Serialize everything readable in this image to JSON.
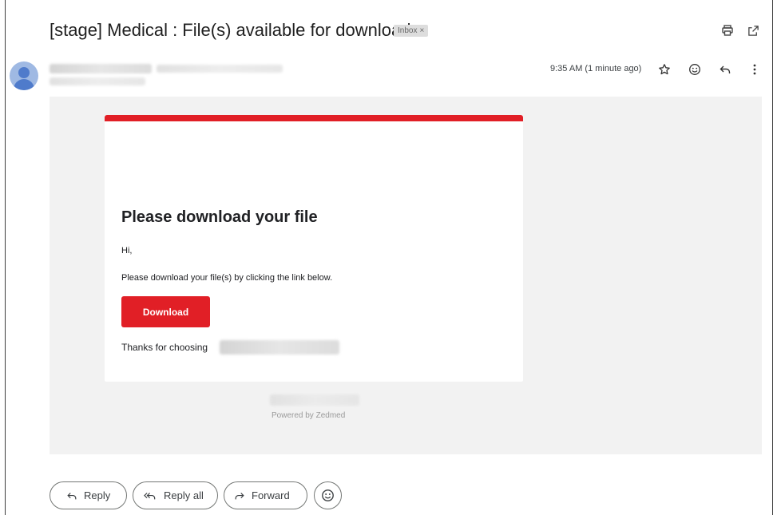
{
  "header": {
    "subject": "[stage] Medical : File(s) available for download",
    "label_badge": "Inbox",
    "label_badge_close": "×",
    "icons": [
      "print-icon",
      "open-in-new-window-icon"
    ]
  },
  "sender": {
    "timestamp": "9:35 AM (1 minute ago)",
    "icons": [
      "star-icon",
      "emoji-reaction-icon",
      "reply-icon",
      "more-options-icon"
    ]
  },
  "email": {
    "accent_color": "#e11f26",
    "title": "Please download your file",
    "greeting": "Hi,",
    "instruction": "Please download your file(s) by clicking the link below.",
    "button_label": "Download",
    "thanks": "Thanks for choosing",
    "footer": "Powered by Zedmed"
  },
  "actions": {
    "reply": "Reply",
    "reply_all": "Reply all",
    "forward": "Forward"
  }
}
